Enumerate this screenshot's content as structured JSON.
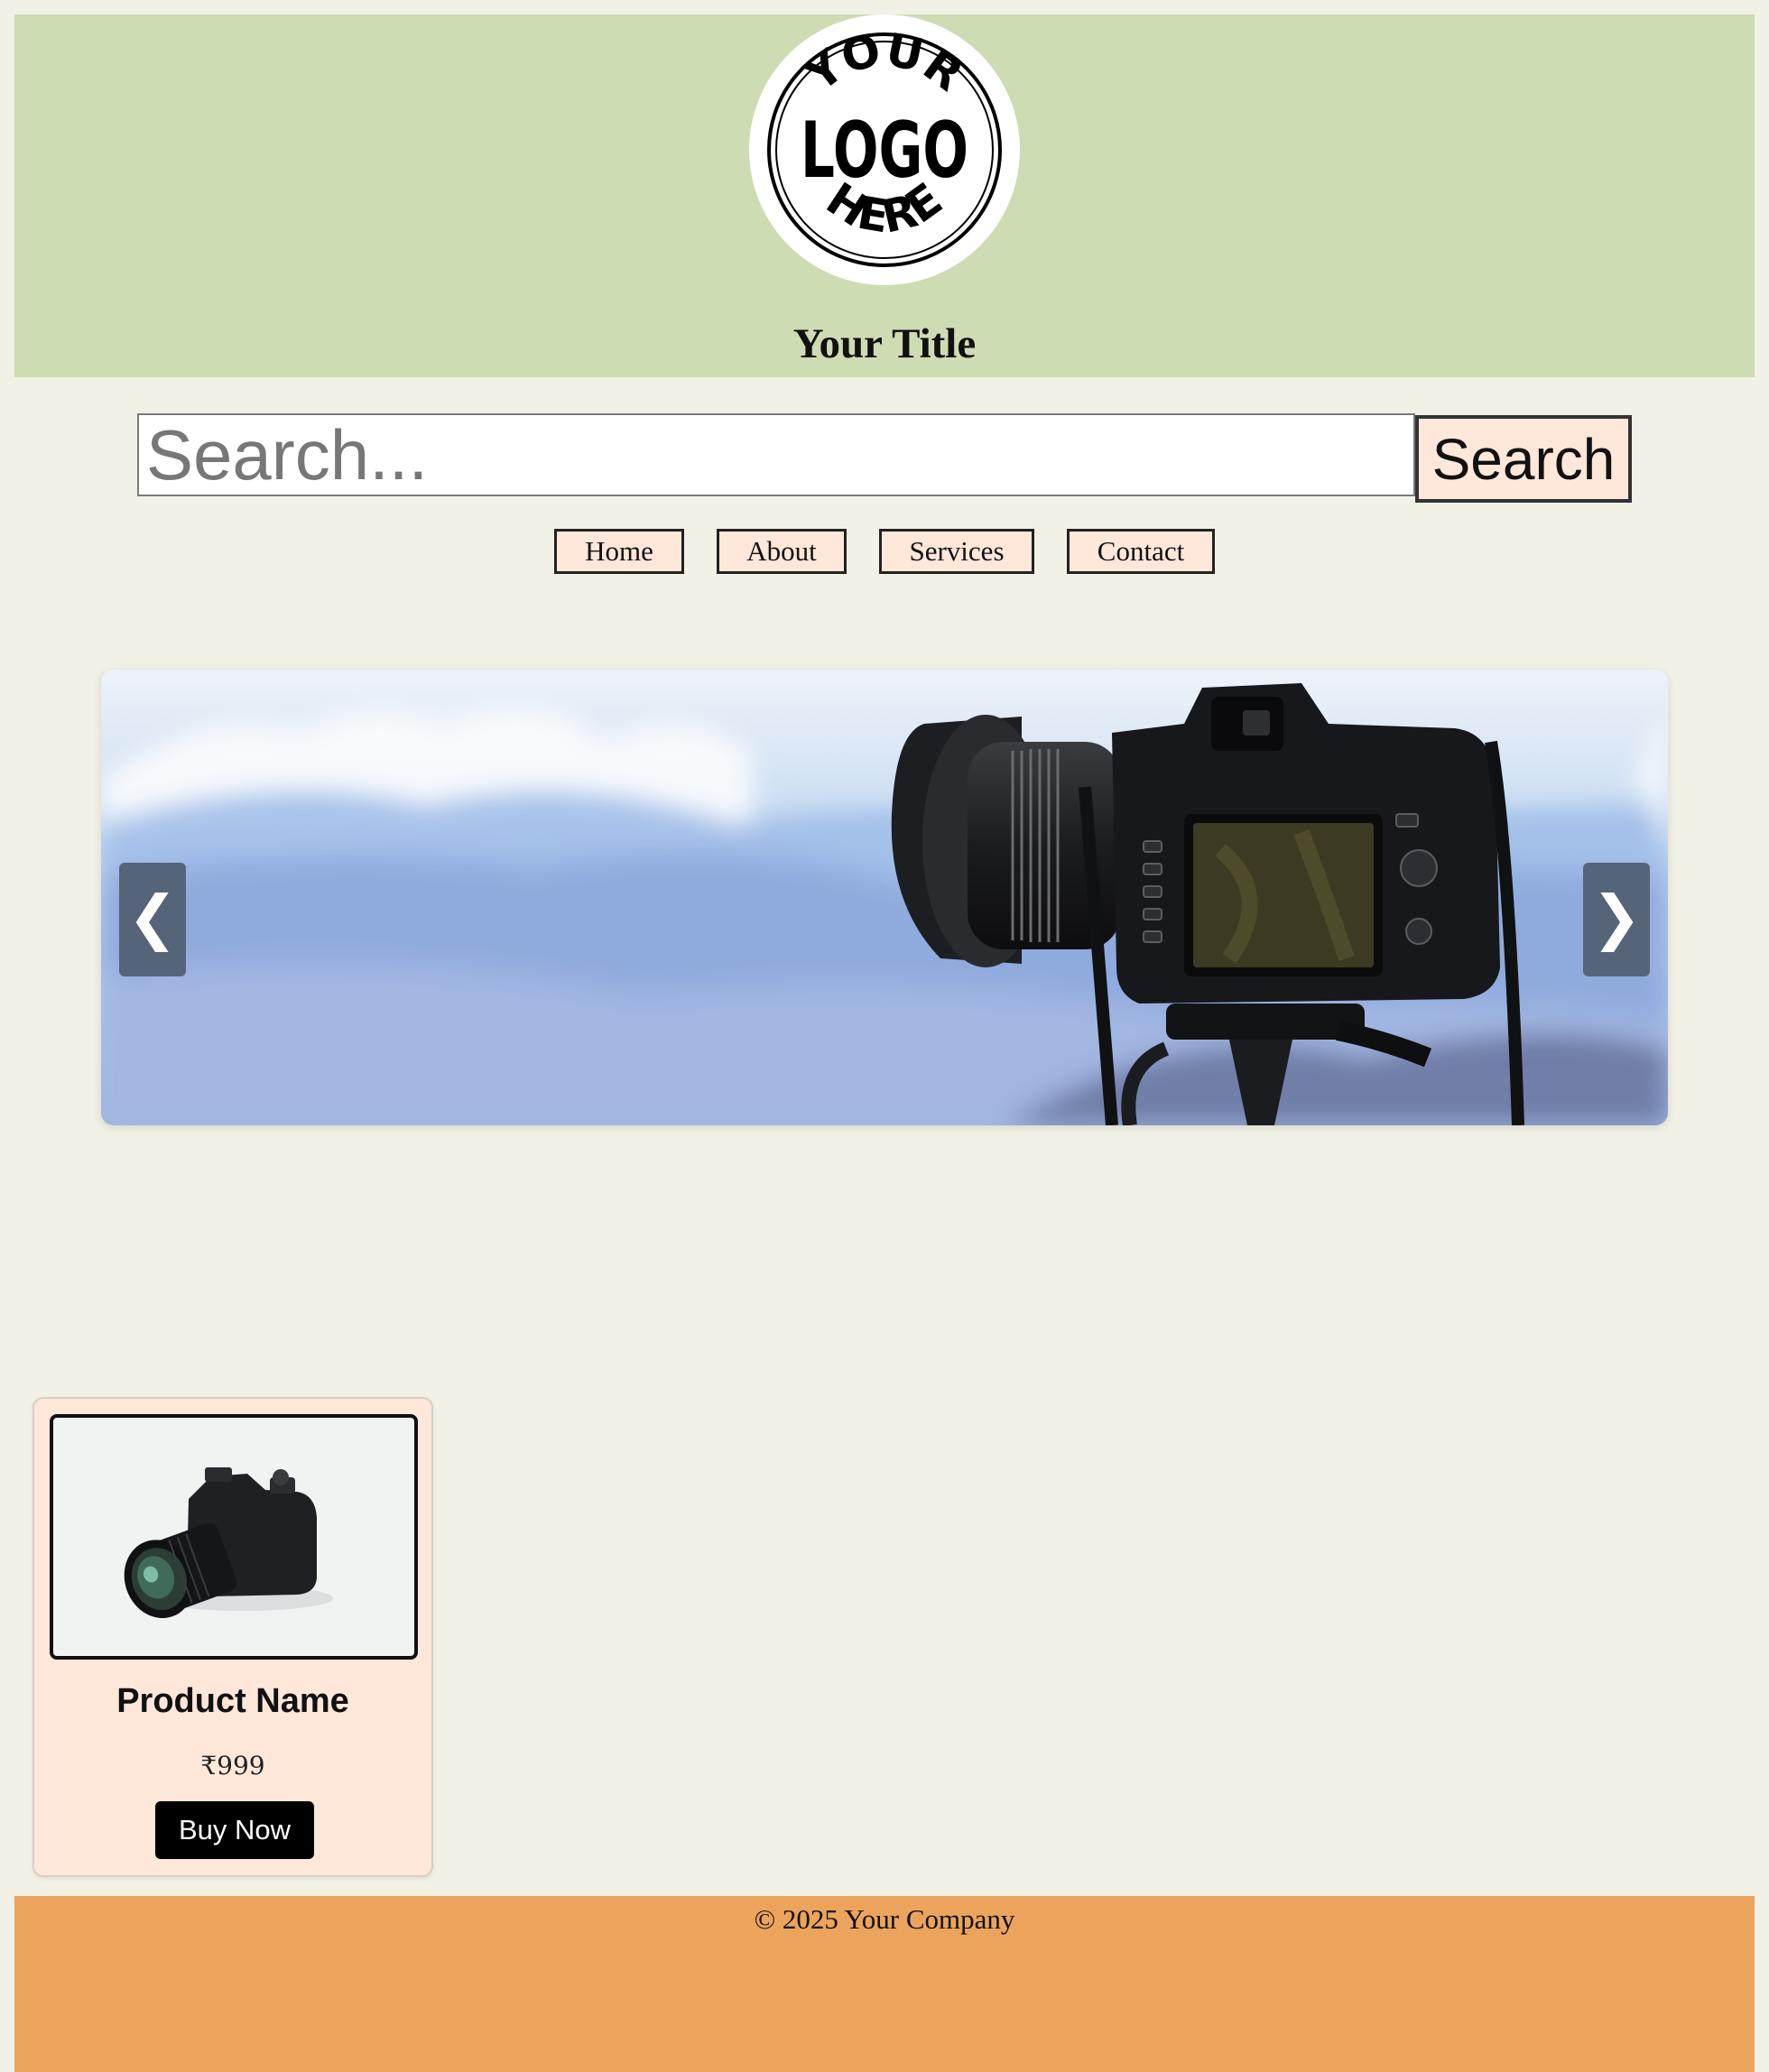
{
  "header": {
    "logo_text": [
      "YOUR",
      "LOGO",
      "HERE"
    ],
    "title": "Your Title",
    "background": "#cddcb2"
  },
  "search": {
    "placeholder": "Search...",
    "button_label": "Search"
  },
  "nav": {
    "items": [
      {
        "label": "Home"
      },
      {
        "label": "About"
      },
      {
        "label": "Services"
      },
      {
        "label": "Contact"
      }
    ]
  },
  "carousel": {
    "prev_label": "❮",
    "next_label": "❯",
    "image": "camera-on-tripod-mountain-landscape"
  },
  "product": {
    "image": "mirrorless-camera",
    "name": "Product Name",
    "price": "₹999",
    "button_label": "Buy Now"
  },
  "footer": {
    "text": "© 2025 Your Company",
    "background": "#eca45c"
  },
  "colors": {
    "page_background": "#f1f1e6",
    "button_background": "#ffe7da",
    "arrow_background": "#56647a"
  }
}
